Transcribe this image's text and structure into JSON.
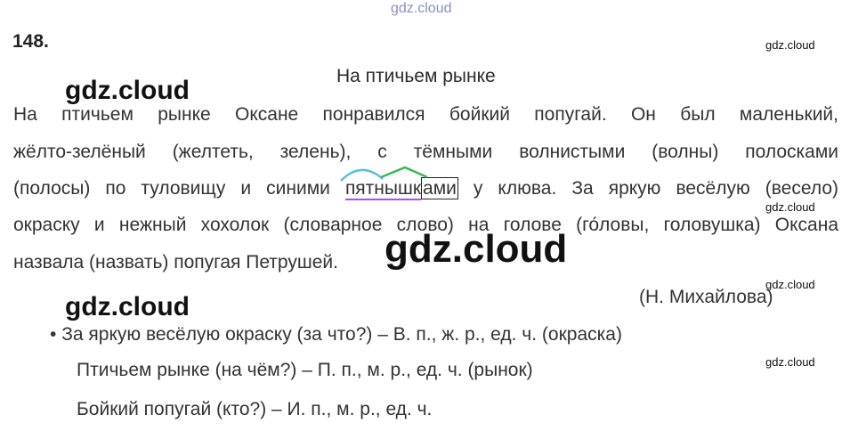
{
  "watermark": {
    "top": "gdz.cloud",
    "small": "gdz.cloud",
    "big": "gdz.cloud"
  },
  "exercise": {
    "number": "148."
  },
  "text": {
    "title": "На птичьем рынке",
    "line1": "На птичьем рынке Оксане понравился бойкий попугай. Он был маленький,",
    "line2": "жёлто-зелёный (желтеть, зелень), с тёмными волнистыми (волны) полосками",
    "line3_before": "(полосы) по туловищу и синими ",
    "line3_root": "пятнышк",
    "line3_ending": "ами",
    "line3_after": " у клюва. За яркую весёлую (весело)",
    "line4": "окраску и нежный хохолок (словарное слово) на голове (го́ловы, головушка) Оксана",
    "line5": "назвала (назвать) попугая Петрушей.",
    "author": "(Н. Михайлова)"
  },
  "answers": {
    "bullet": "•",
    "line1": "За яркую весёлую окраску (за что?) – В. п., ж. р., ед. ч. (окраска)",
    "line2": "Птичьем рынке (на чём?) – П. п., м. р., ед. ч. (рынок)",
    "line3": "Бойкий попугай (кто?) – И. п., м. р., ед. ч."
  },
  "colors": {
    "prefix_arc": "#5bbfe0",
    "suffix_mark": "#33bb55",
    "root_underline": "#a05bd0"
  }
}
